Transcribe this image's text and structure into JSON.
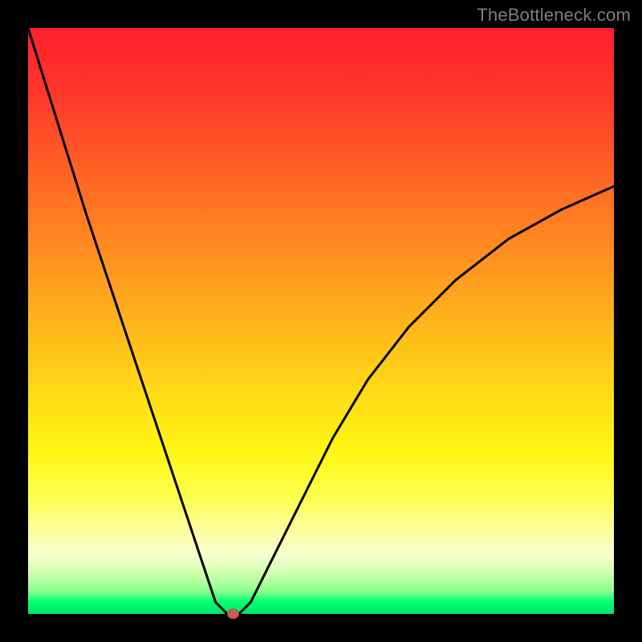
{
  "watermark": "TheBottleneck.com",
  "chart_data": {
    "type": "line",
    "title": "",
    "xlabel": "",
    "ylabel": "",
    "xlim": [
      0,
      1
    ],
    "ylim": [
      0,
      1
    ],
    "series": [
      {
        "name": "bottleneck-curve",
        "x": [
          0.0,
          0.05,
          0.1,
          0.15,
          0.2,
          0.25,
          0.3,
          0.32,
          0.34,
          0.35,
          0.36,
          0.38,
          0.4,
          0.43,
          0.47,
          0.52,
          0.58,
          0.65,
          0.73,
          0.82,
          0.91,
          1.0
        ],
        "y": [
          1.0,
          0.84,
          0.68,
          0.53,
          0.38,
          0.23,
          0.08,
          0.02,
          0.0,
          0.0,
          0.0,
          0.02,
          0.06,
          0.12,
          0.2,
          0.3,
          0.4,
          0.49,
          0.57,
          0.64,
          0.69,
          0.73
        ]
      }
    ],
    "marker": {
      "name": "optimum-point",
      "x": 0.35,
      "y": 0.0,
      "color": "#d15a52"
    },
    "background": {
      "type": "vertical-gradient",
      "stops": [
        {
          "pos": 0.0,
          "color": "#ff1f2f"
        },
        {
          "pos": 0.5,
          "color": "#ffba1a"
        },
        {
          "pos": 0.8,
          "color": "#fdff4e"
        },
        {
          "pos": 1.0,
          "color": "#00e56a"
        }
      ]
    },
    "frame_color": "#000000"
  }
}
